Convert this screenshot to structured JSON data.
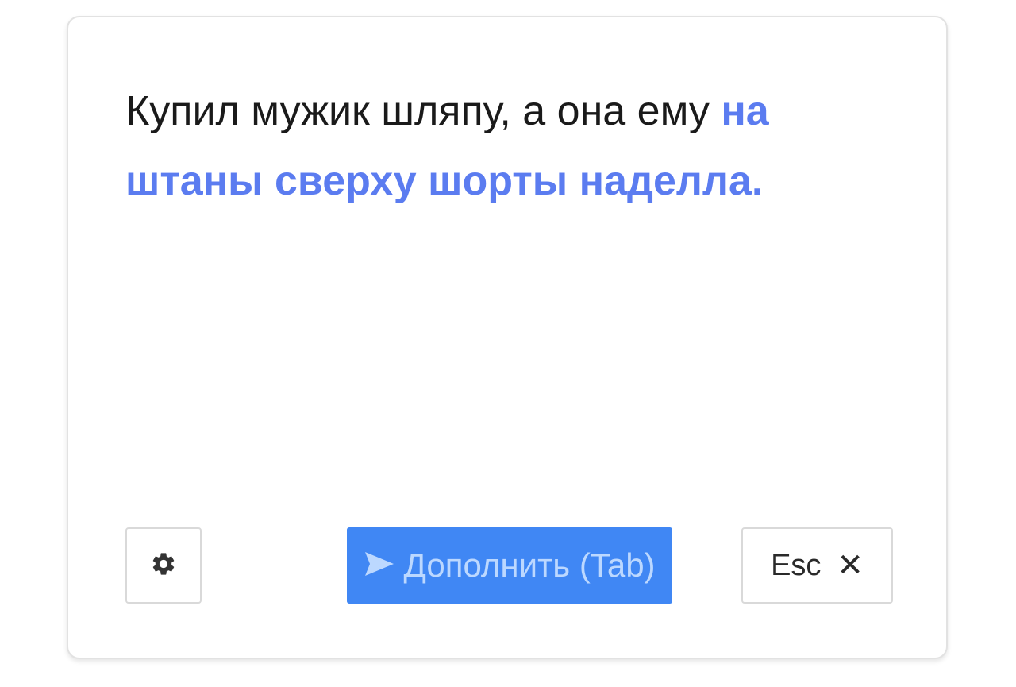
{
  "editor": {
    "typed_text": "Купил мужик шляпу, а она ему ",
    "suggestion_text": "на штаны сверху шорты наделла.",
    "suggestion_color": "#5b7cf0"
  },
  "toolbar": {
    "settings_icon": "gear-icon",
    "complete_icon": "send-arrow-icon",
    "complete_label": "Дополнить (Tab)",
    "complete_bg": "#4087f4",
    "esc_label": "Esc",
    "close_icon": "close-icon",
    "close_glyph": "✕"
  }
}
